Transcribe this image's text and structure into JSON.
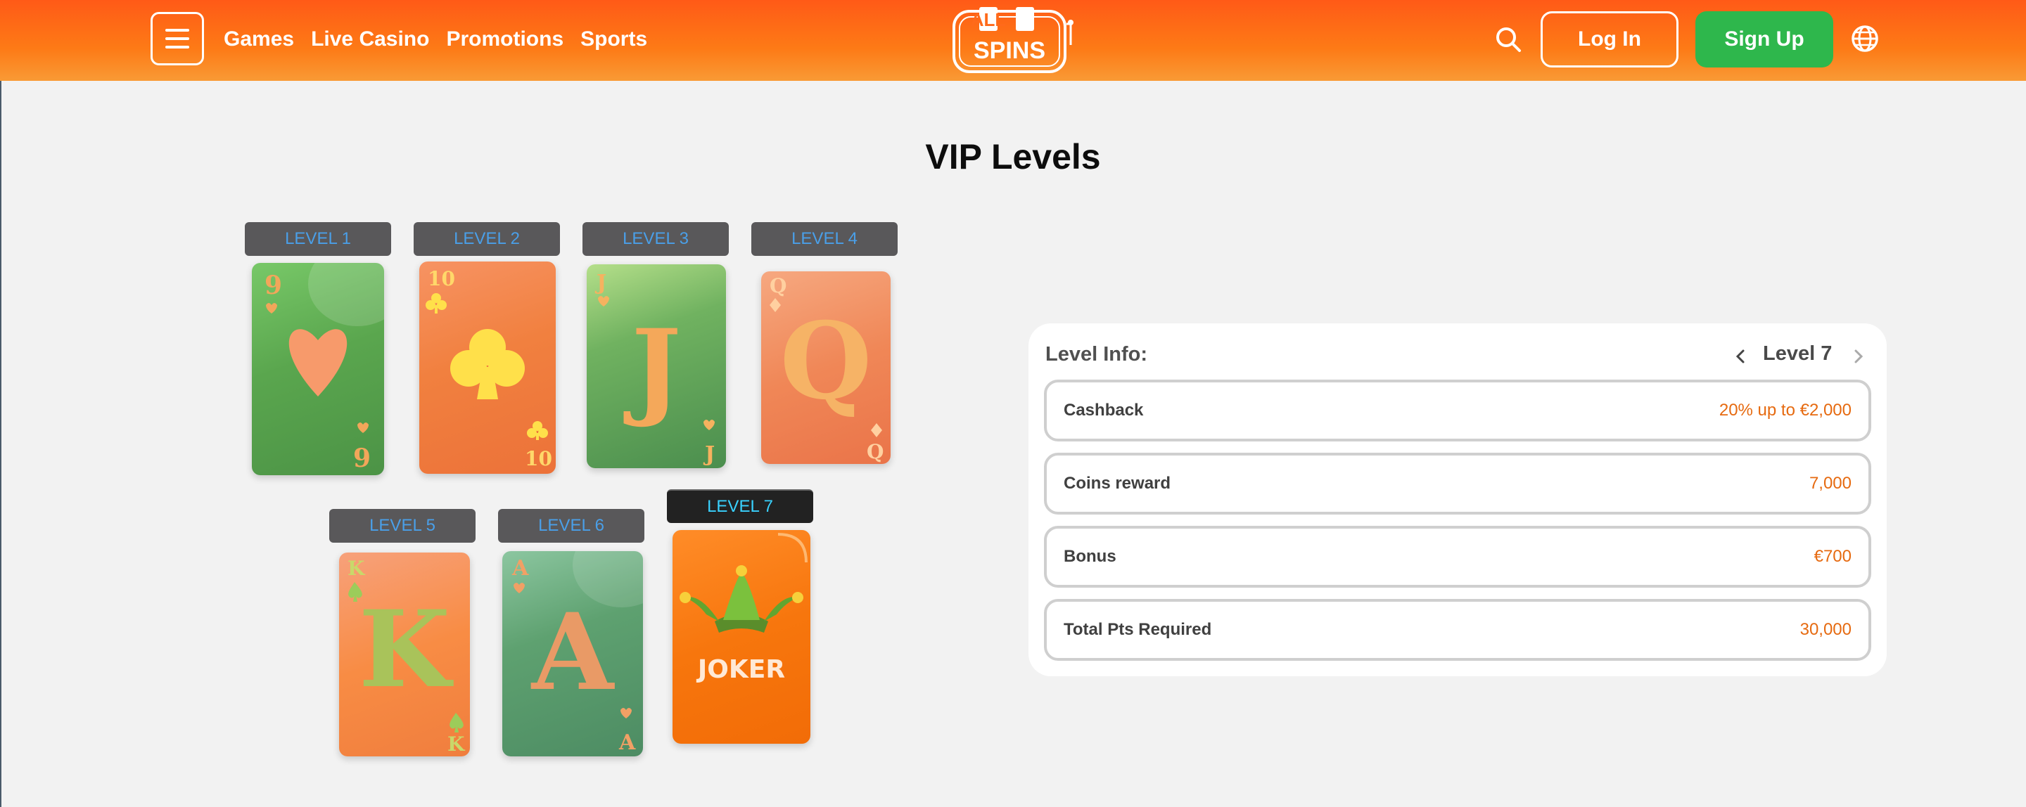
{
  "header": {
    "nav": [
      "Games",
      "Live Casino",
      "Promotions",
      "Sports"
    ],
    "logo": {
      "top": "ALL",
      "bottom": "SPINS"
    },
    "login_label": "Log In",
    "signup_label": "Sign Up",
    "icons": {
      "menu": "hamburger-menu-icon",
      "search": "search-icon",
      "language": "globe-icon"
    },
    "colors": {
      "header_start": "#ff5a17",
      "header_end": "#f99a35",
      "signup": "#2eb74c"
    }
  },
  "page": {
    "title": "VIP Levels"
  },
  "levels": [
    {
      "label": "LEVEL 1",
      "card_rank": "9",
      "suit": "heart"
    },
    {
      "label": "LEVEL 2",
      "card_rank": "10",
      "suit": "club"
    },
    {
      "label": "LEVEL 3",
      "card_rank": "J",
      "suit": "heart"
    },
    {
      "label": "LEVEL 4",
      "card_rank": "Q",
      "suit": "diamond"
    },
    {
      "label": "LEVEL 5",
      "card_rank": "K",
      "suit": "spade"
    },
    {
      "label": "LEVEL 6",
      "card_rank": "A",
      "suit": "heart"
    },
    {
      "label": "LEVEL 7",
      "card_rank": "JOKER",
      "suit": "jester-hat",
      "selected": true
    }
  ],
  "info": {
    "title": "Level Info:",
    "current_level": "Level 7",
    "rows": [
      {
        "label": "Cashback",
        "value": "20% up to €2,000"
      },
      {
        "label": "Coins reward",
        "value": "7,000"
      },
      {
        "label": "Bonus",
        "value": "€700"
      },
      {
        "label": "Total Pts Required",
        "value": "30,000"
      }
    ],
    "accent_color": "#e66a10"
  }
}
